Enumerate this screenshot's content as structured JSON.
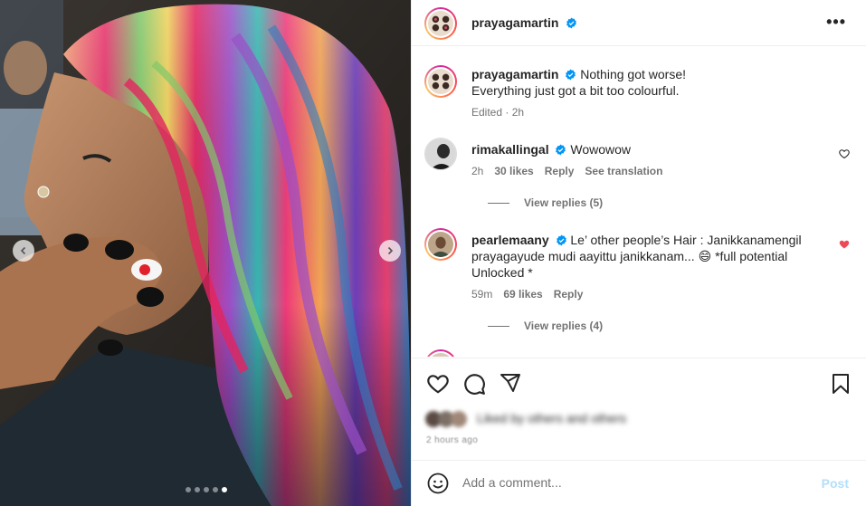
{
  "post": {
    "author": "prayagamartin",
    "caption_line1": "Nothing got worse!",
    "caption_line2": "Everything just got a bit too colourful.",
    "caption_meta": "Edited · 2h",
    "more_label": "•••",
    "carousel": {
      "slides": 5,
      "active_index": 4
    }
  },
  "comments": [
    {
      "username": "rimakallingal",
      "verified": true,
      "text": "Wowowow",
      "time": "2h",
      "likes": "30 likes",
      "reply": "Reply",
      "translate": "See translation",
      "view_replies": "View replies (5)",
      "liked": false
    },
    {
      "username": "pearlemaany",
      "verified": true,
      "text_line1": "Le’ other people’s Hair : Janikkanamengil",
      "text_line2": "prayagayude mudi aayittu janikkanam... 😄 *full potential",
      "text_line3": "Unlocked *",
      "time": "59m",
      "likes": "69 likes",
      "reply": "Reply",
      "view_replies": "View replies (4)",
      "liked": true
    }
  ],
  "actions": {
    "icons": [
      "heart-icon",
      "comment-icon",
      "share-icon",
      "bookmark-icon"
    ]
  },
  "likes_summary": "Liked by others and others",
  "post_time": "2 hours ago",
  "add_comment": {
    "placeholder": "Add a comment...",
    "post_label": "Post"
  },
  "colors": {
    "verified": "#0095f6",
    "liked_heart": "#ed4956",
    "post_disabled": "#b2dffc",
    "meta_gray": "#737373"
  }
}
